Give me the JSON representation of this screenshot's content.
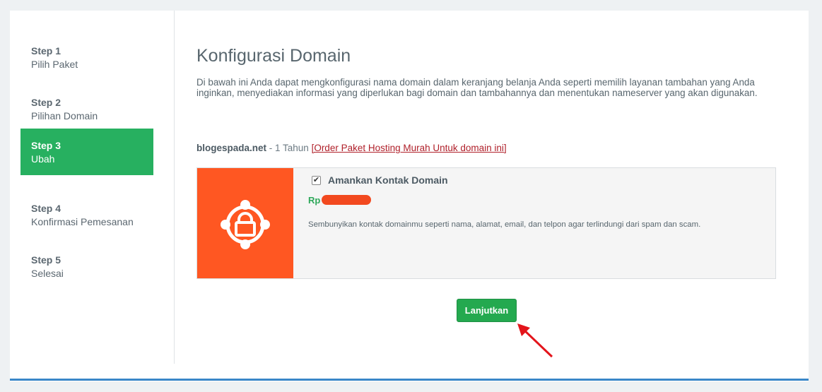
{
  "sidebar": {
    "steps": [
      {
        "num": "Step 1",
        "label": "Pilih Paket"
      },
      {
        "num": "Step 2",
        "label": "Pilihan Domain"
      },
      {
        "num": "Step 3",
        "label": "Ubah"
      },
      {
        "num": "Step 4",
        "label": "Konfirmasi Pemesanan"
      },
      {
        "num": "Step 5",
        "label": "Selesai"
      }
    ],
    "active_step": "Step 3"
  },
  "main": {
    "title": "Konfigurasi Domain",
    "description": "Di bawah ini Anda dapat mengkonfigurasi nama domain dalam keranjang belanja Anda seperti memilih layanan tambahan yang Anda inginkan, menyediakan informasi yang diperlukan bagi domain dan tambahannya dan menentukan nameserver yang akan digunakan.",
    "domain": {
      "name": "blogespada.net",
      "term": " - 1 Tahun ",
      "hosting_link": "[Order Paket Hosting Murah Untuk domain ini]"
    },
    "addon": {
      "checked": true,
      "name": "Amankan Kontak Domain",
      "price_prefix": "Rp",
      "description": "Sembunyikan kontak domainmu seperti nama, alamat, email, dan telpon agar terlindungi dari spam dan scam.",
      "icon": "lock-shield-icon"
    },
    "continue_label": "Lanjutkan"
  },
  "colors": {
    "active_step": "#27b060",
    "addon_icon_bg": "#ff5722",
    "button": "#24a94f",
    "link": "#b0202a",
    "accent_bar": "#3a87c8"
  }
}
